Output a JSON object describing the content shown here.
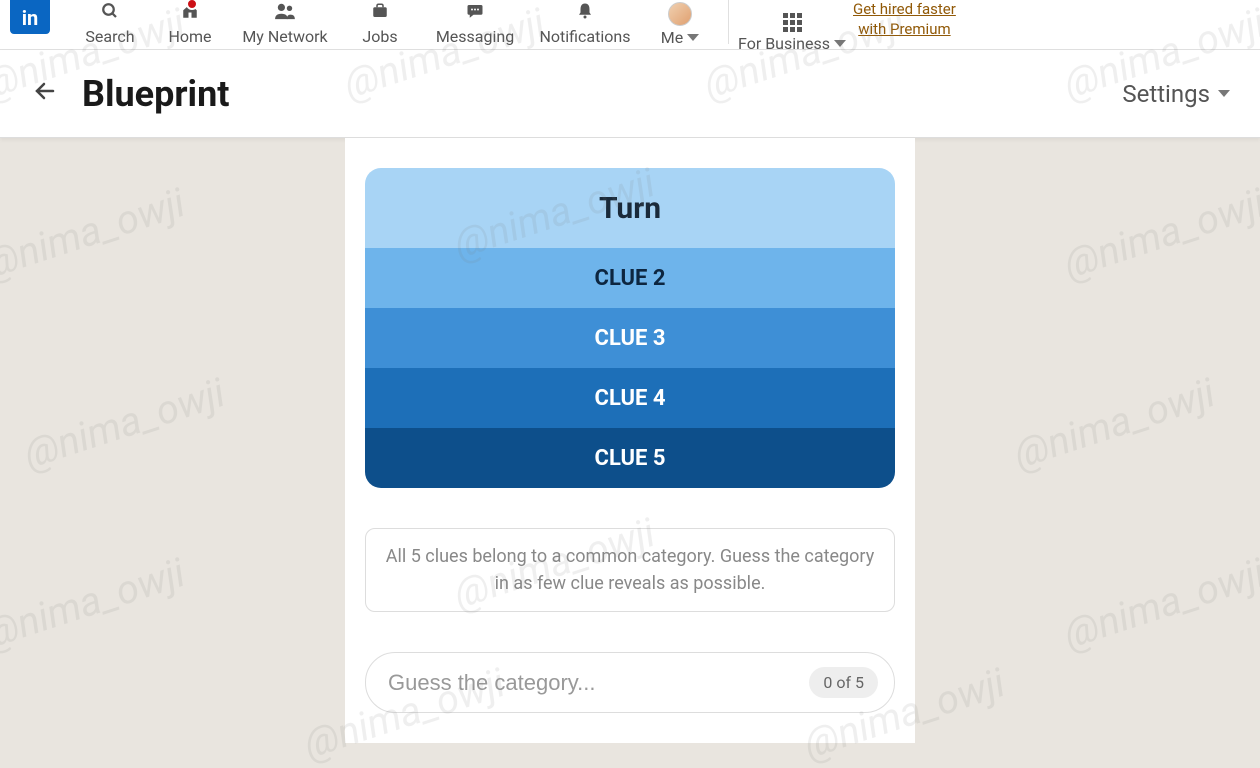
{
  "topnav": {
    "items": [
      {
        "label": "Search"
      },
      {
        "label": "Home"
      },
      {
        "label": "My Network"
      },
      {
        "label": "Jobs"
      },
      {
        "label": "Messaging"
      },
      {
        "label": "Notifications"
      },
      {
        "label": "Me"
      },
      {
        "label": "For Business"
      }
    ],
    "premium_line1": "Get hired faster",
    "premium_line2": "with Premium"
  },
  "subheader": {
    "title": "Blueprint",
    "settings_label": "Settings"
  },
  "game": {
    "clues": [
      "Turn",
      "CLUE 2",
      "CLUE 3",
      "CLUE 4",
      "CLUE 5"
    ],
    "hint": "All 5 clues belong to a common category. Guess the category in as few clue reveals as possible.",
    "placeholder": "Guess the category...",
    "counter": "0 of 5"
  },
  "watermark": "@nima_owji"
}
